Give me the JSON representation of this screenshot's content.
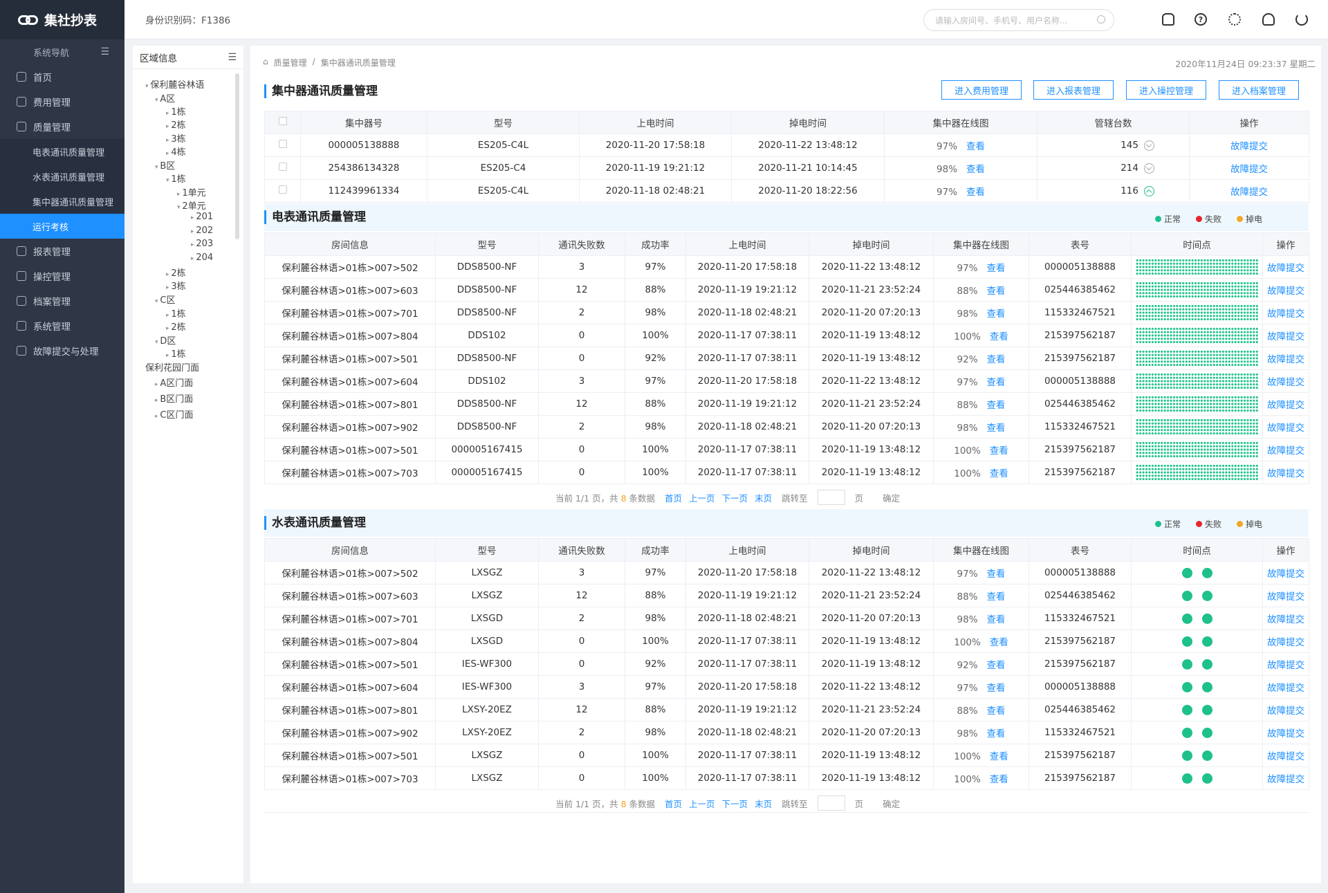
{
  "app": {
    "logo_text": "集社抄表"
  },
  "header": {
    "ident_label": "身份识别码：F1386",
    "search_placeholder": "请输入房间号、手机号、用户名称..."
  },
  "sidebar": {
    "nav_title": "系统导航",
    "items": [
      {
        "label": "首页"
      },
      {
        "label": "费用管理"
      },
      {
        "label": "质量管理"
      },
      {
        "label": "电表通讯质量管理"
      },
      {
        "label": "水表通讯质量管理"
      },
      {
        "label": "集中器通讯质量管理"
      },
      {
        "label": "运行考核"
      },
      {
        "label": "报表管理"
      },
      {
        "label": "操控管理"
      },
      {
        "label": "档案管理"
      },
      {
        "label": "系统管理"
      },
      {
        "label": "故障提交与处理"
      }
    ]
  },
  "region": {
    "title": "区域信息",
    "tree": [
      "保利麓谷林语",
      "A区",
      "1栋",
      "2栋",
      "3栋",
      "4栋",
      "B区",
      "1栋",
      "1单元",
      "2单元",
      "201",
      "202",
      "203",
      "204",
      "2栋",
      "3栋",
      "C区",
      "1栋",
      "2栋",
      "D区",
      "1栋",
      "保利花园门面",
      "A区门面",
      "B区门面",
      "C区门面"
    ]
  },
  "breadcrumb": [
    "质量管理",
    "集中器通讯质量管理"
  ],
  "datetime": "2020年11月24日 09:23:37 星期二",
  "top_buttons": [
    "进入费用管理",
    "进入报表管理",
    "进入操控管理",
    "进入档案管理"
  ],
  "concentrator": {
    "title": "集中器通讯质量管理",
    "headers": [
      "集中器号",
      "型号",
      "上电时间",
      "掉电时间",
      "集中器在线图",
      "管辖台数",
      "操作"
    ],
    "rows": [
      {
        "id": "000005138888",
        "model": "ES205-C4L",
        "on": "2020-11-20  17:58:18",
        "off": "2020-11-22  13:48:12",
        "pct": "97%",
        "view": "查看",
        "count": "145",
        "op": "故障提交",
        "expanded": false
      },
      {
        "id": "254386134328",
        "model": "ES205-C4",
        "on": "2020-11-19  19:21:12",
        "off": "2020-11-21  10:14:45",
        "pct": "98%",
        "view": "查看",
        "count": "214",
        "op": "故障提交",
        "expanded": false
      },
      {
        "id": "112439961334",
        "model": "ES205-C4L",
        "on": "2020-11-18  02:48:21",
        "off": "2020-11-20  18:22:56",
        "pct": "97%",
        "view": "查看",
        "count": "116",
        "op": "故障提交",
        "expanded": true
      }
    ]
  },
  "legend": {
    "normal": "正常",
    "fail": "失败",
    "off": "掉电"
  },
  "legend_colors": {
    "normal": "#1ec18a",
    "fail": "#e8232c",
    "off": "#f5a623"
  },
  "meter": {
    "title": "电表通讯质量管理",
    "headers": [
      "房间信息",
      "型号",
      "通讯失败数",
      "成功率",
      "上电时间",
      "掉电时间",
      "集中器在线图",
      "表号",
      "时间点",
      "操作"
    ],
    "rows": [
      {
        "room": "保利麓谷林语>01栋>007>502",
        "model": "DDS8500-NF",
        "fail": "3",
        "rate": "97%",
        "on": "2020-11-20  17:58:18",
        "off": "2020-11-22  13:48:12",
        "pct": "97%",
        "view": "查看",
        "no": "000005138888",
        "op": "故障提交"
      },
      {
        "room": "保利麓谷林语>01栋>007>603",
        "model": "DDS8500-NF",
        "fail": "12",
        "rate": "88%",
        "on": "2020-11-19  19:21:12",
        "off": "2020-11-21  23:52:24",
        "pct": "88%",
        "view": "查看",
        "no": "025446385462",
        "op": "故障提交"
      },
      {
        "room": "保利麓谷林语>01栋>007>701",
        "model": "DDS8500-NF",
        "fail": "2",
        "rate": "98%",
        "on": "2020-11-18  02:48:21",
        "off": "2020-11-20  07:20:13",
        "pct": "98%",
        "view": "查看",
        "no": "115332467521",
        "op": "故障提交"
      },
      {
        "room": "保利麓谷林语>01栋>007>804",
        "model": "DDS102",
        "fail": "0",
        "rate": "100%",
        "on": "2020-11-17  07:38:11",
        "off": "2020-11-19  13:48:12",
        "pct": "100%",
        "view": "查看",
        "no": "215397562187",
        "op": "故障提交"
      },
      {
        "room": "保利麓谷林语>01栋>007>501",
        "model": "DDS8500-NF",
        "fail": "0",
        "rate": "92%",
        "on": "2020-11-17  07:38:11",
        "off": "2020-11-19  13:48:12",
        "pct": "92%",
        "view": "查看",
        "no": "215397562187",
        "op": "故障提交"
      },
      {
        "room": "保利麓谷林语>01栋>007>604",
        "model": "DDS102",
        "fail": "3",
        "rate": "97%",
        "on": "2020-11-20  17:58:18",
        "off": "2020-11-22  13:48:12",
        "pct": "97%",
        "view": "查看",
        "no": "000005138888",
        "op": "故障提交"
      },
      {
        "room": "保利麓谷林语>01栋>007>801",
        "model": "DDS8500-NF",
        "fail": "12",
        "rate": "88%",
        "on": "2020-11-19  19:21:12",
        "off": "2020-11-21  23:52:24",
        "pct": "88%",
        "view": "查看",
        "no": "025446385462",
        "op": "故障提交"
      },
      {
        "room": "保利麓谷林语>01栋>007>902",
        "model": "DDS8500-NF",
        "fail": "2",
        "rate": "98%",
        "on": "2020-11-18  02:48:21",
        "off": "2020-11-20  07:20:13",
        "pct": "98%",
        "view": "查看",
        "no": "115332467521",
        "op": "故障提交"
      },
      {
        "room": "保利麓谷林语>01栋>007>501",
        "model": "000005167415",
        "fail": "0",
        "rate": "100%",
        "on": "2020-11-17  07:38:11",
        "off": "2020-11-19  13:48:12",
        "pct": "100%",
        "view": "查看",
        "no": "215397562187",
        "op": "故障提交"
      },
      {
        "room": "保利麓谷林语>01栋>007>703",
        "model": "000005167415",
        "fail": "0",
        "rate": "100%",
        "on": "2020-11-17  07:38:11",
        "off": "2020-11-19  13:48:12",
        "pct": "100%",
        "view": "查看",
        "no": "215397562187",
        "op": "故障提交"
      }
    ]
  },
  "water": {
    "title": "水表通讯质量管理",
    "headers": [
      "房间信息",
      "型号",
      "通讯失败数",
      "成功率",
      "上电时间",
      "掉电时间",
      "集中器在线图",
      "表号",
      "时间点",
      "操作"
    ],
    "rows": [
      {
        "room": "保利麓谷林语>01栋>007>502",
        "model": "LXSGZ",
        "fail": "3",
        "rate": "97%",
        "on": "2020-11-20  17:58:18",
        "off": "2020-11-22  13:48:12",
        "pct": "97%",
        "view": "查看",
        "no": "000005138888",
        "op": "故障提交"
      },
      {
        "room": "保利麓谷林语>01栋>007>603",
        "model": "LXSGZ",
        "fail": "12",
        "rate": "88%",
        "on": "2020-11-19  19:21:12",
        "off": "2020-11-21  23:52:24",
        "pct": "88%",
        "view": "查看",
        "no": "025446385462",
        "op": "故障提交"
      },
      {
        "room": "保利麓谷林语>01栋>007>701",
        "model": "LXSGD",
        "fail": "2",
        "rate": "98%",
        "on": "2020-11-18  02:48:21",
        "off": "2020-11-20  07:20:13",
        "pct": "98%",
        "view": "查看",
        "no": "115332467521",
        "op": "故障提交"
      },
      {
        "room": "保利麓谷林语>01栋>007>804",
        "model": "LXSGD",
        "fail": "0",
        "rate": "100%",
        "on": "2020-11-17  07:38:11",
        "off": "2020-11-19  13:48:12",
        "pct": "100%",
        "view": "查看",
        "no": "215397562187",
        "op": "故障提交"
      },
      {
        "room": "保利麓谷林语>01栋>007>501",
        "model": "IES-WF300",
        "fail": "0",
        "rate": "92%",
        "on": "2020-11-17  07:38:11",
        "off": "2020-11-19  13:48:12",
        "pct": "92%",
        "view": "查看",
        "no": "215397562187",
        "op": "故障提交"
      },
      {
        "room": "保利麓谷林语>01栋>007>604",
        "model": "IES-WF300",
        "fail": "3",
        "rate": "97%",
        "on": "2020-11-20  17:58:18",
        "off": "2020-11-22  13:48:12",
        "pct": "97%",
        "view": "查看",
        "no": "000005138888",
        "op": "故障提交"
      },
      {
        "room": "保利麓谷林语>01栋>007>801",
        "model": "LXSY-20EZ",
        "fail": "12",
        "rate": "88%",
        "on": "2020-11-19  19:21:12",
        "off": "2020-11-21  23:52:24",
        "pct": "88%",
        "view": "查看",
        "no": "025446385462",
        "op": "故障提交"
      },
      {
        "room": "保利麓谷林语>01栋>007>902",
        "model": "LXSY-20EZ",
        "fail": "2",
        "rate": "98%",
        "on": "2020-11-18  02:48:21",
        "off": "2020-11-20  07:20:13",
        "pct": "98%",
        "view": "查看",
        "no": "115332467521",
        "op": "故障提交"
      },
      {
        "room": "保利麓谷林语>01栋>007>501",
        "model": "LXSGZ",
        "fail": "0",
        "rate": "100%",
        "on": "2020-11-17  07:38:11",
        "off": "2020-11-19  13:48:12",
        "pct": "100%",
        "view": "查看",
        "no": "215397562187",
        "op": "故障提交"
      },
      {
        "room": "保利麓谷林语>01栋>007>703",
        "model": "LXSGZ",
        "fail": "0",
        "rate": "100%",
        "on": "2020-11-17  07:38:11",
        "off": "2020-11-19  13:48:12",
        "pct": "100%",
        "view": "查看",
        "no": "215397562187",
        "op": "故障提交"
      }
    ]
  },
  "pager": {
    "prefix": "当前 1/1 页，共",
    "count": "8",
    "suffix": "条数据",
    "first": "首页",
    "prev": "上一页",
    "next": "下一页",
    "last": "末页",
    "jump": "跳转至",
    "page": "页",
    "confirm": "确定"
  }
}
